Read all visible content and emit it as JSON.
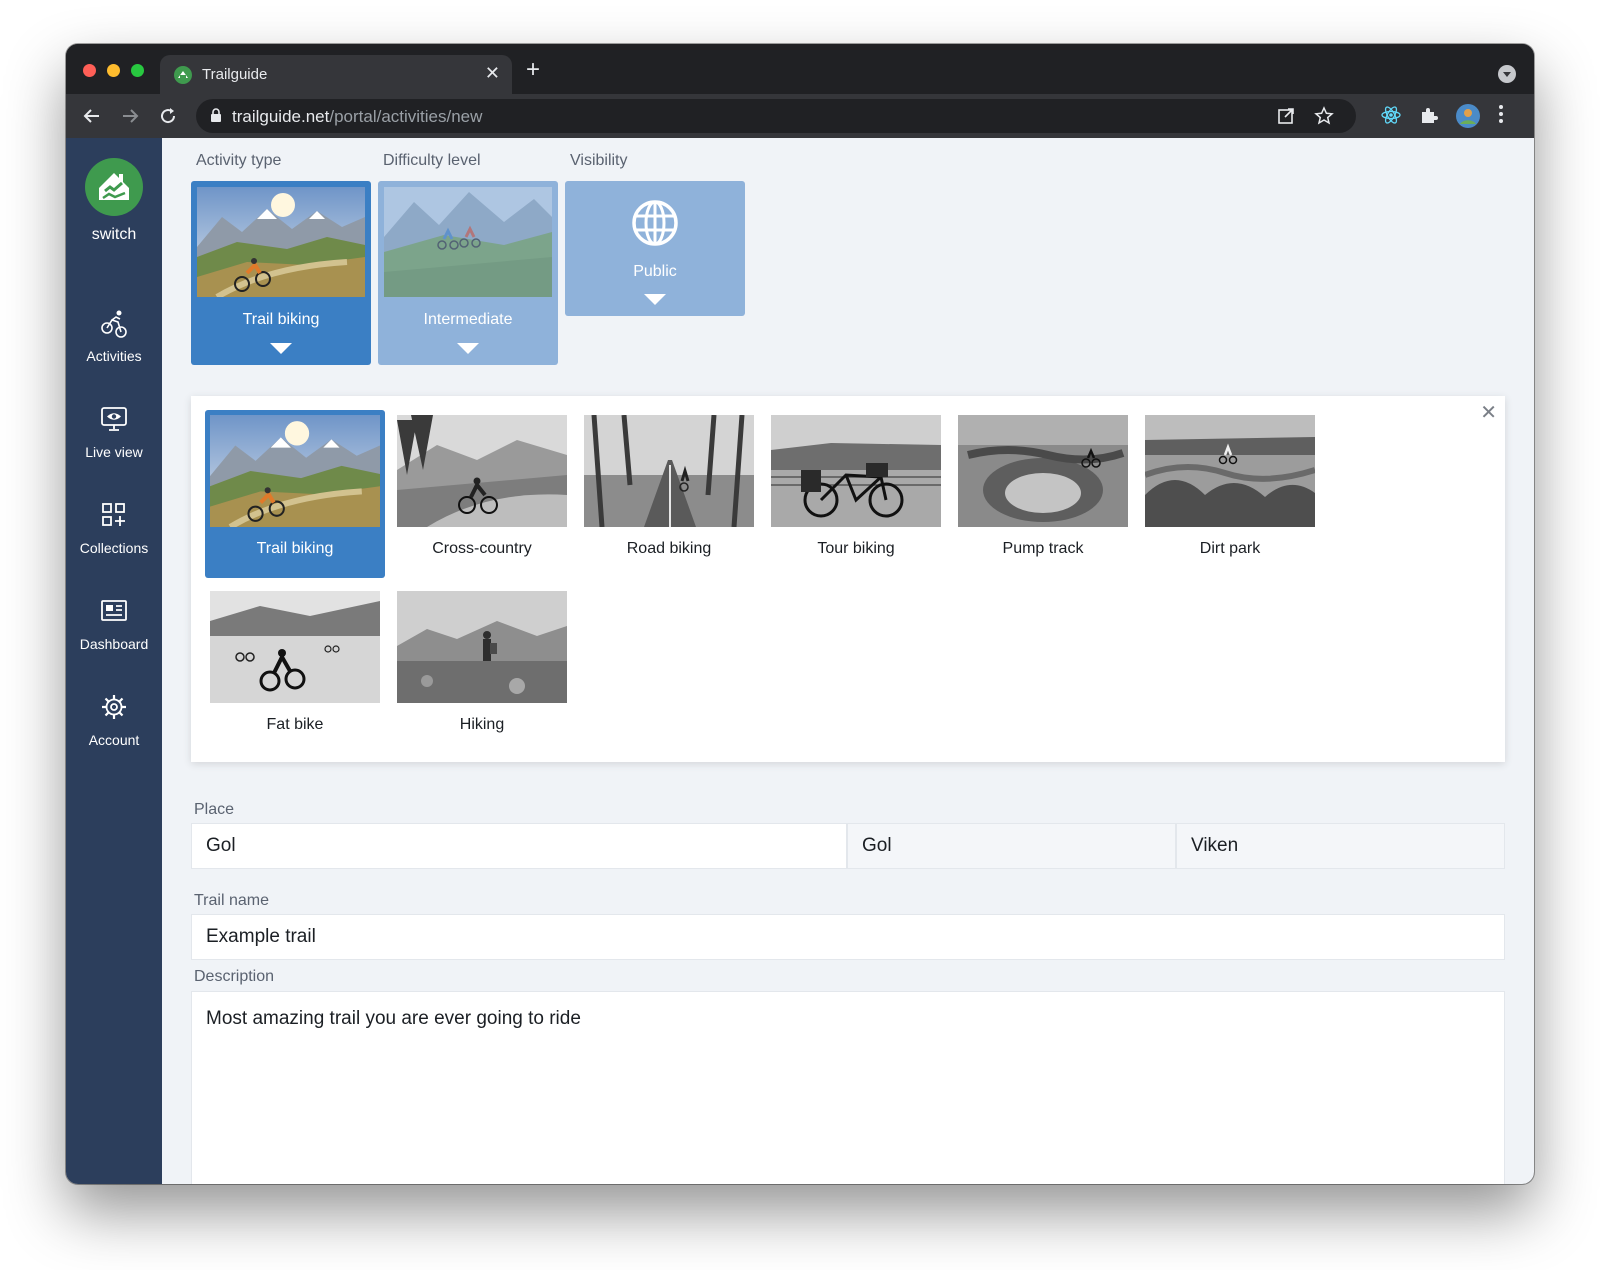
{
  "browser": {
    "tab_title": "Trailguide",
    "tab_close": "✕",
    "new_tab": "+",
    "url_host": "trailguide.net",
    "url_path": "/portal/activities/new"
  },
  "sidebar": {
    "switch_label": "switch",
    "items": [
      {
        "label": "Activities",
        "icon": "bike-icon"
      },
      {
        "label": "Live view",
        "icon": "monitor-eye-icon"
      },
      {
        "label": "Collections",
        "icon": "collections-icon"
      },
      {
        "label": "Dashboard",
        "icon": "dashboard-icon"
      },
      {
        "label": "Account",
        "icon": "gear-icon"
      }
    ]
  },
  "selectors": {
    "activity_type": {
      "label": "Activity type",
      "value": "Trail biking"
    },
    "difficulty": {
      "label": "Difficulty level",
      "value": "Intermediate"
    },
    "visibility": {
      "label": "Visibility",
      "value": "Public",
      "icon": "globe-icon"
    }
  },
  "activity_panel": {
    "close": "✕",
    "options": [
      {
        "label": "Trail biking",
        "selected": true
      },
      {
        "label": "Cross-country",
        "selected": false
      },
      {
        "label": "Road biking",
        "selected": false
      },
      {
        "label": "Tour biking",
        "selected": false
      },
      {
        "label": "Pump track",
        "selected": false
      },
      {
        "label": "Dirt park",
        "selected": false
      },
      {
        "label": "Fat bike",
        "selected": false
      },
      {
        "label": "Hiking",
        "selected": false
      }
    ]
  },
  "form": {
    "place_label": "Place",
    "place_value": "Gol",
    "place_municipality": "Gol",
    "place_county": "Viken",
    "trail_name_label": "Trail name",
    "trail_name_value": "Example trail",
    "description_label": "Description",
    "description_value": "Most amazing trail you are ever going to ride"
  },
  "colors": {
    "sidebar": "#2c3e5c",
    "selected": "#3b7fc4",
    "inactive_selector": "#8fb2da",
    "logo": "#3f9a4e"
  }
}
